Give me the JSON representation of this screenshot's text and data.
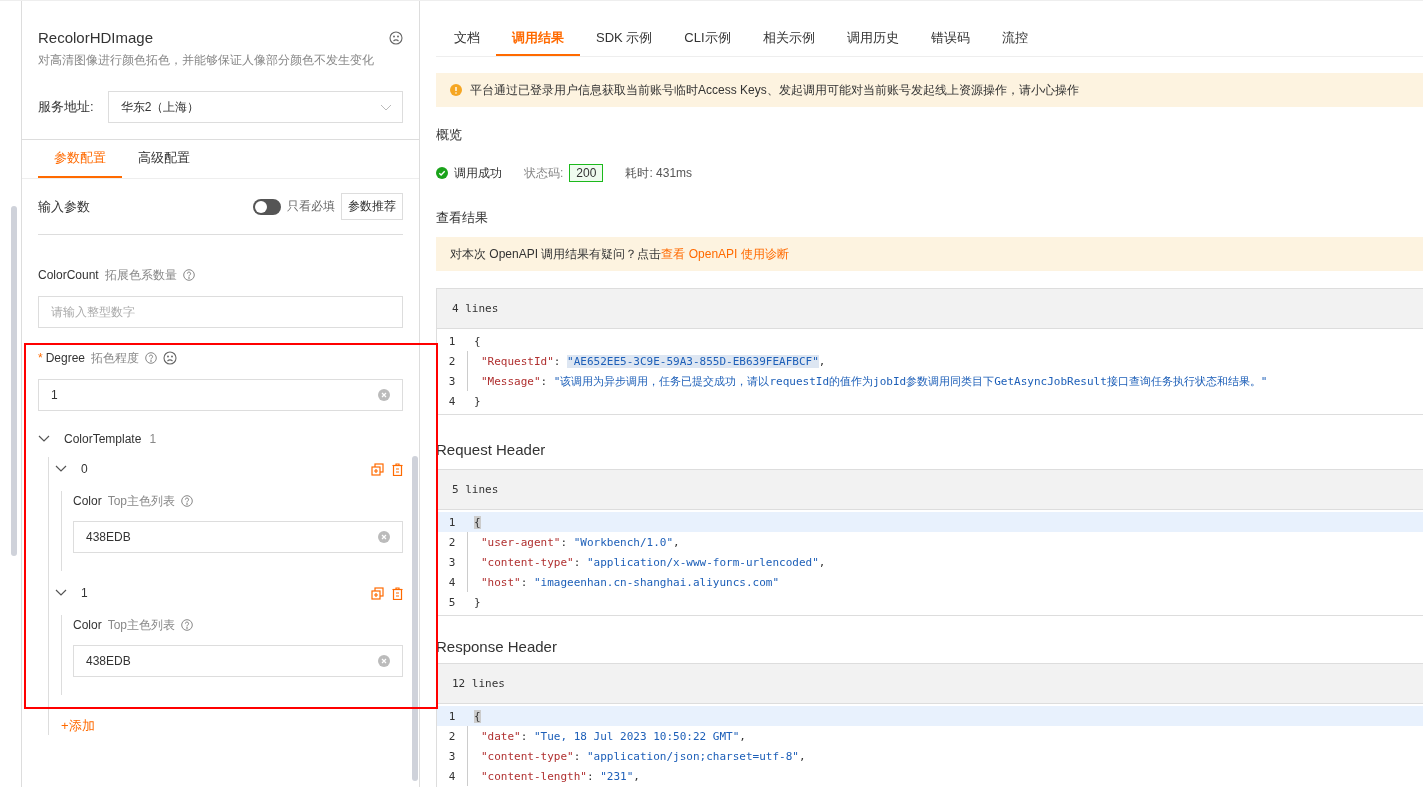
{
  "api_panel": {
    "title": "RecolorHDImage",
    "description": "对高清图像进行颜色拓色，并能够保证人像部分颜色不发生变化",
    "service": {
      "label": "服务地址:",
      "value": "华东2（上海）"
    },
    "tabs": [
      {
        "label": "参数配置",
        "selected": true
      },
      {
        "label": "高级配置",
        "selected": false
      }
    ],
    "input_header": {
      "title": "输入参数",
      "toggle_label": "只看必填",
      "toggle_on": false,
      "recommend_button": "参数推荐"
    },
    "params": [
      {
        "name": "ColorCount",
        "desc": "拓展色系数量",
        "required": false,
        "placeholder": "请输入整型数字"
      },
      {
        "name": "Degree",
        "desc": "拓色程度",
        "required": true,
        "required_mark": "*",
        "value": "1"
      }
    ],
    "template": {
      "name": "ColorTemplate",
      "count": "1",
      "expanded": true,
      "items": [
        {
          "index": "0",
          "expanded": true,
          "field": "Color",
          "desc": "Top主色列表",
          "value": "438EDB"
        },
        {
          "index": "1",
          "expanded": true,
          "field": "Color",
          "desc": "Top主色列表",
          "value": "438EDB"
        }
      ],
      "add_label": "+添加"
    }
  },
  "result_panel": {
    "tabs": [
      {
        "label": "文档",
        "selected": false
      },
      {
        "label": "调用结果",
        "selected": true
      },
      {
        "label": "SDK 示例",
        "selected": false
      },
      {
        "label": "CLI示例",
        "selected": false
      },
      {
        "label": "相关示例",
        "selected": false
      },
      {
        "label": "调用历史",
        "selected": false
      },
      {
        "label": "错误码",
        "selected": false
      },
      {
        "label": "流控",
        "selected": false
      }
    ],
    "warning": "平台通过已登录用户信息获取当前账号临时Access Keys、发起调用可能对当前账号发起线上资源操作，请小心操作",
    "overview_title": "概览",
    "status": {
      "text": "调用成功",
      "code_label": "状态码:",
      "code": "200",
      "time": "耗时: 431ms"
    },
    "result_title": "查看结果",
    "hint": {
      "text": "对本次 OpenAPI 调用结果有疑问？点击",
      "link": "查看 OpenAPI 使用诊断"
    },
    "code_blocks": [
      {
        "lines_label": "4 lines",
        "lines": [
          {
            "number": "1",
            "brace": "{",
            "selected": false
          },
          {
            "number": "2",
            "key": "\"RequestId\"",
            "colon": ":",
            "value": "\"AE652EE5-3C9E-59A3-855D-EB639FEAFBCF\"",
            "value_selected": true,
            "trail": ",",
            "selected": false
          },
          {
            "number": "3",
            "key": "\"Message\"",
            "colon": ":",
            "value": "\"该调用为异步调用，任务已提交成功，请以requestId的值作为jobId参数调用同类目下GetAsyncJobResult接口查询任务执行状态和结果。\"",
            "value_selected": false,
            "selected": false
          },
          {
            "number": "4",
            "brace": "}",
            "selected": false
          }
        ]
      },
      {
        "title": "Request Header",
        "lines_label": "5 lines",
        "lines": [
          {
            "number": "1",
            "brace": "{",
            "selected": true
          },
          {
            "number": "2",
            "key": "\"user-agent\"",
            "colon": ":",
            "value": "\"Workbench/1.0\"",
            "value_selected": false,
            "trail": ",",
            "selected": false
          },
          {
            "number": "3",
            "key": "\"content-type\"",
            "colon": ":",
            "value": "\"application/x-www-form-urlencoded\"",
            "value_selected": false,
            "trail": ",",
            "selected": false
          },
          {
            "number": "4",
            "key": "\"host\"",
            "colon": ":",
            "value": "\"imageenhan.cn-shanghai.aliyuncs.com\"",
            "value_selected": false,
            "selected": false
          },
          {
            "number": "5",
            "brace": "}",
            "selected": false
          }
        ]
      },
      {
        "title": "Response Header",
        "lines_label": "12 lines",
        "lines": [
          {
            "number": "1",
            "brace": "{",
            "selected": true
          },
          {
            "number": "2",
            "key": "\"date\"",
            "colon": ":",
            "value": "\"Tue, 18 Jul 2023 10:50:22 GMT\"",
            "value_selected": false,
            "trail": ",",
            "selected": false
          },
          {
            "number": "3",
            "key": "\"content-type\"",
            "colon": ":",
            "value": "\"application/json;charset=utf-8\"",
            "value_selected": false,
            "trail": ",",
            "selected": false
          },
          {
            "number": "4",
            "key": "\"content-length\"",
            "colon": ":",
            "value": "\"231\"",
            "value_selected": false,
            "trail": ",",
            "selected": false
          }
        ]
      }
    ]
  }
}
